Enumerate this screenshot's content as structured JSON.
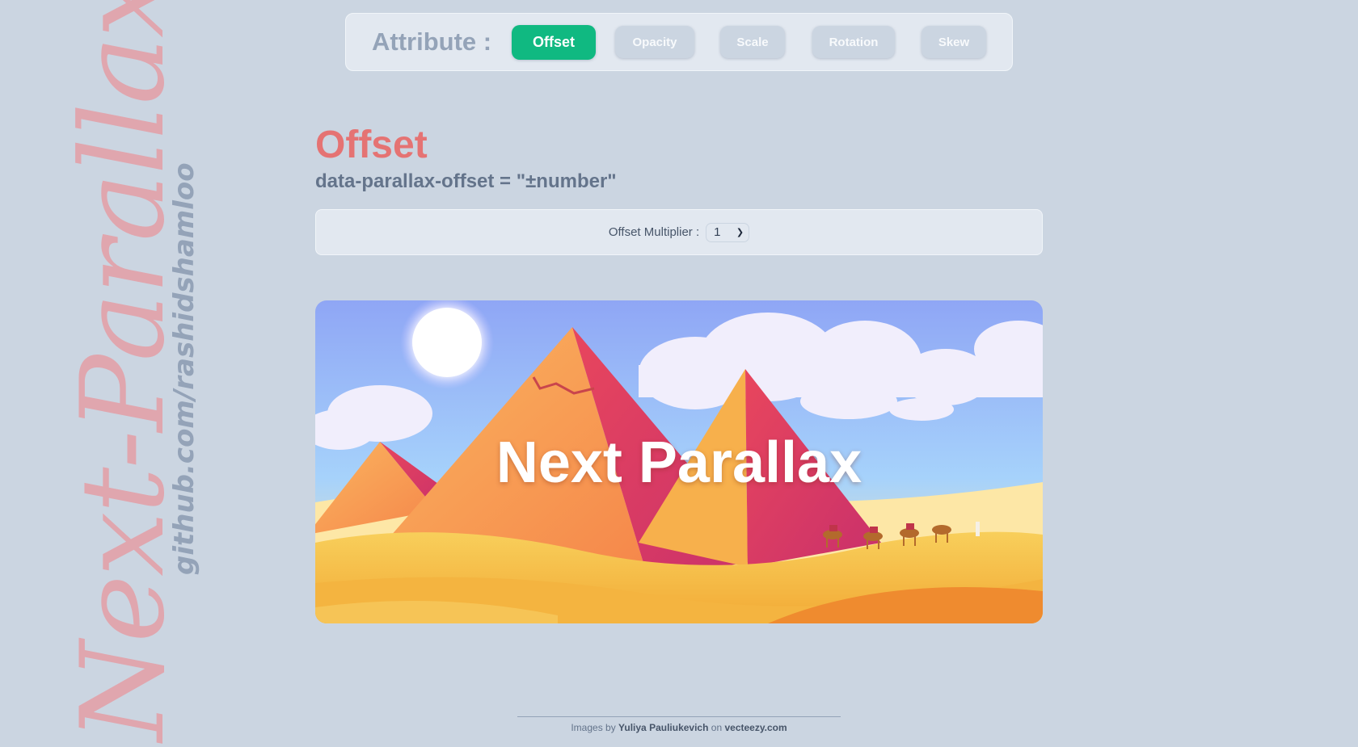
{
  "sidebar": {
    "logo_text": "Next-Parallax",
    "github_text": "github.com/rashidshamloo"
  },
  "toolbar": {
    "label": "Attribute :",
    "tabs": [
      {
        "label": "Offset",
        "active": true
      },
      {
        "label": "Opacity",
        "active": false
      },
      {
        "label": "Scale",
        "active": false
      },
      {
        "label": "Rotation",
        "active": false
      },
      {
        "label": "Skew",
        "active": false
      }
    ]
  },
  "section": {
    "title": "Offset",
    "attribute": "data-parallax-offset = \"±number\""
  },
  "controls": {
    "multiplier_label": "Offset Multiplier :",
    "multiplier_value": "1"
  },
  "hero": {
    "title": "Next Parallax"
  },
  "footer": {
    "prefix": "Images by",
    "author": "Yuliya Pauliukevich",
    "mid": "on",
    "site": "vecteezy.com"
  },
  "colors": {
    "background": "#cbd5e1",
    "accent": "#10b981",
    "title": "#e57373"
  }
}
